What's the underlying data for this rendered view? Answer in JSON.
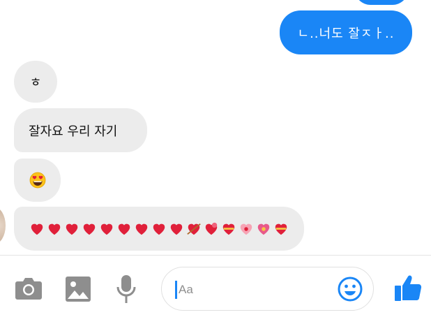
{
  "messages": {
    "outgoing_1": "ㄴ..너도 잘ㅈㅏ..",
    "incoming_1": "ㅎ",
    "incoming_2": "잘자요 우리 자기",
    "incoming_3_emoji": "heart-eyes-emoji",
    "incoming_4_emoji": [
      "red-heart",
      "red-heart",
      "red-heart",
      "red-heart",
      "red-heart",
      "red-heart",
      "red-heart",
      "red-heart",
      "red-heart",
      "heart-with-arrow",
      "revolving-hearts",
      "heart-with-ribbon",
      "growing-heart",
      "sparkling-heart",
      "heart-with-ribbon"
    ]
  },
  "composer": {
    "placeholder": "Aa",
    "icons": [
      "camera-icon",
      "image-icon",
      "microphone-icon",
      "emoji-smiley-icon",
      "thumbs-up-icon"
    ]
  },
  "colors": {
    "accent": "#1a86f6",
    "bubble_incoming": "#ececec",
    "icon_gray": "#909090",
    "heart": "#e0203a"
  }
}
